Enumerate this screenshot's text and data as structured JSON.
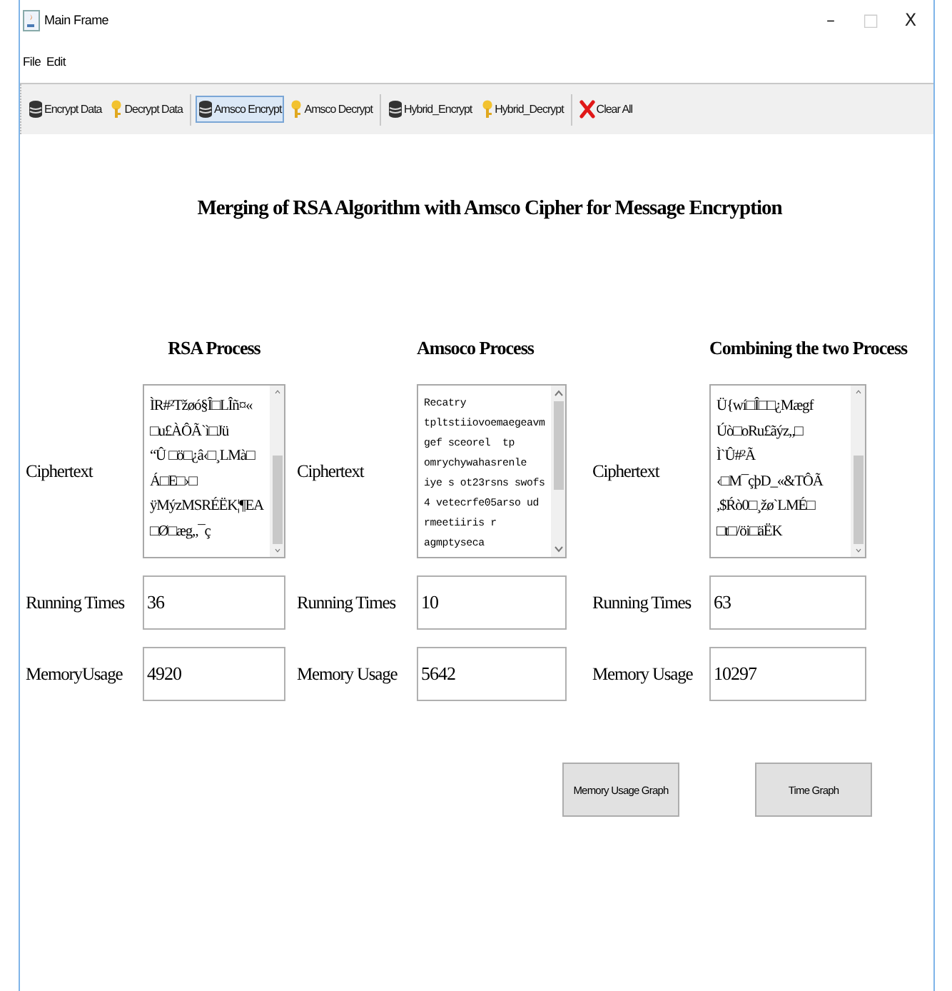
{
  "window": {
    "title": "Main Frame",
    "controls": [
      {
        "label": "–",
        "disabled": false
      },
      {
        "label": "□",
        "disabled": true
      },
      {
        "label": "X",
        "disabled": false
      }
    ]
  },
  "menu": [
    {
      "label": "File"
    },
    {
      "label": "Edit"
    }
  ],
  "toolbar": [
    {
      "label": "Encrypt Data",
      "kind": "encrypt",
      "selected": false
    },
    {
      "label": "Decrypt Data",
      "kind": "decrypt",
      "selected": false
    },
    {
      "kind": "separator"
    },
    {
      "label": "Amsco Encrypt",
      "kind": "encrypt",
      "selected": true
    },
    {
      "label": "Amsco Decrypt",
      "kind": "decrypt",
      "selected": false
    },
    {
      "kind": "separator"
    },
    {
      "label": "Hybrid_Encrypt",
      "kind": "encrypt",
      "selected": false
    },
    {
      "label": "Hybrid_Decrypt",
      "kind": "decrypt",
      "selected": false
    },
    {
      "kind": "separator"
    },
    {
      "label": "Clear All",
      "kind": "clear",
      "selected": false
    }
  ],
  "heading": "Merging of RSA Algorithm with Amsco Cipher for Message Encryption",
  "sections": [
    {
      "title": "RSA Process",
      "mono": false,
      "ciphertext_label": "Ciphertext",
      "ciphertext": "ÌR#²Tžøó§Î□LÎñ¤«\n□u£ÀÔÃ`ì□Jü\n“Û □ö□¿â‹□¸LMà□\nÁ□E□›□\nÿMýzMSRÉËK¦¶EA\n□Ø□æg„¯ç",
      "time_label": "Running Times",
      "time": "36",
      "memory_label": "MemoryUsage",
      "memory": "4920"
    },
    {
      "title": "Amsoco Process",
      "mono": true,
      "ciphertext_label": "Ciphertext",
      "ciphertext": "Recatry\ntpltstiiovoemaegeavm\ngef sceorel  tp\nomrychywahasrenle\niye s ot23rsns swofs\n4 vetecrfe05arso ud\nrmeetiiris r\nagmptyseca",
      "time_label": "Running Times",
      "time": "10",
      "memory_label": "Memory Usage",
      "memory": "5642"
    },
    {
      "title": "Combining the two Process",
      "mono": false,
      "ciphertext_label": "Ciphertext",
      "ciphertext": "Ü{wí□Î□□¿Mægf\nÚò□oRu£ãýz„□\nÌ`Û#²Ã\n‹□M¯çþD_«&TÔÃ\n,$Ŕò0□¸žø`LMÉ□\n□t□/öi□äËK",
      "time_label": "Running Times",
      "time": "63",
      "memory_label": "Memory Usage",
      "memory": "10297"
    }
  ],
  "buttons": [
    {
      "label": "Memory Usage Graph"
    },
    {
      "label": "Time Graph"
    }
  ]
}
